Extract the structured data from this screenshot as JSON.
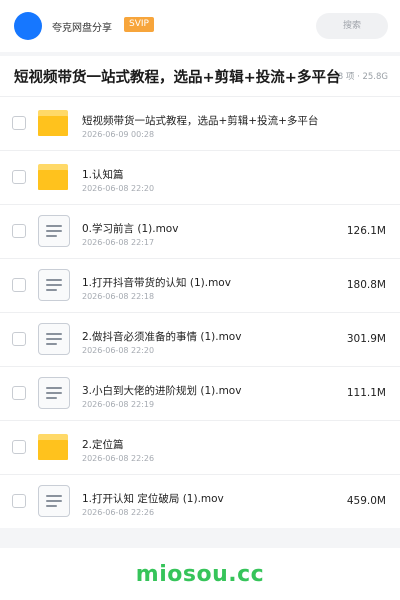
{
  "header": {
    "brand": "夸克网盘分享",
    "badge": "SVIP",
    "search_placeholder": "搜索"
  },
  "share": {
    "title": "短视频带货一站式教程，选品+剪辑+投流+多平台",
    "meta": "8 项 · 25.8G"
  },
  "files": [
    {
      "type": "folder",
      "icon": "folder-icon",
      "name": "短视频带货一站式教程，选品+剪辑+投流+多平台",
      "date": "2026-06-09 00:28",
      "size": ""
    },
    {
      "type": "folder",
      "icon": "folder-icon",
      "name": "1.认知篇",
      "date": "2026-06-08 22:20",
      "size": ""
    },
    {
      "type": "file",
      "icon": "document-icon",
      "name": "0.学习前言 (1).mov",
      "date": "2026-06-08 22:17",
      "size": "126.1M"
    },
    {
      "type": "file",
      "icon": "document-icon",
      "name": "1.打开抖音带货的认知 (1).mov",
      "date": "2026-06-08 22:18",
      "size": "180.8M"
    },
    {
      "type": "file",
      "icon": "document-icon",
      "name": "2.做抖音必须准备的事情 (1).mov",
      "date": "2026-06-08 22:20",
      "size": "301.9M"
    },
    {
      "type": "file",
      "icon": "document-icon",
      "name": "3.小白到大佬的进阶规划 (1).mov",
      "date": "2026-06-08 22:19",
      "size": "111.1M"
    },
    {
      "type": "folder",
      "icon": "folder-icon",
      "name": "2.定位篇",
      "date": "2026-06-08 22:26",
      "size": ""
    },
    {
      "type": "file",
      "icon": "document-icon",
      "name": "1.打开认知 定位破局 (1).mov",
      "date": "2026-06-08 22:26",
      "size": "459.0M"
    }
  ],
  "watermark": "miosou.cc",
  "colors": {
    "accent": "#1677ff",
    "badge": "#f7a53b",
    "folder": "#ffc21d",
    "watermark": "#36c45a"
  }
}
